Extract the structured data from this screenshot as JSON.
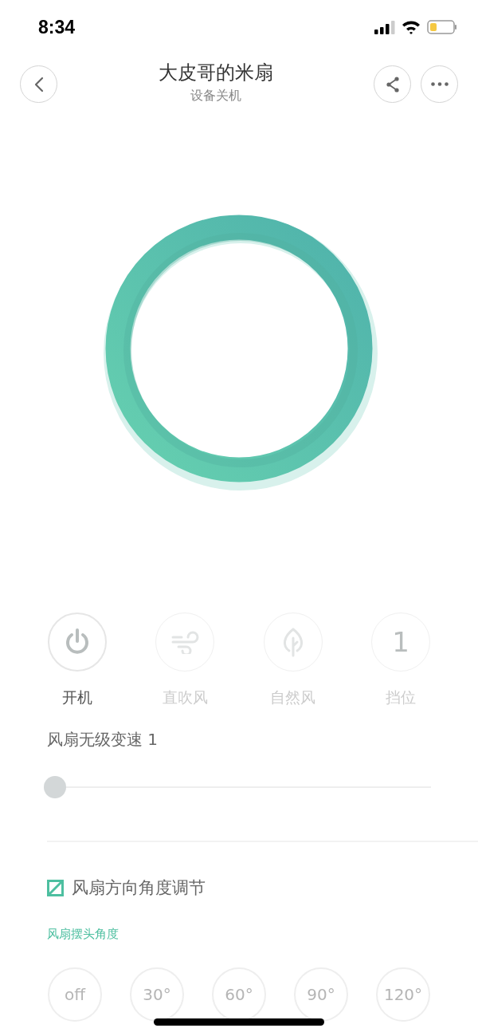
{
  "status_bar": {
    "time": "8:34"
  },
  "header": {
    "title": "大皮哥的米扇",
    "subtitle": "设备关机"
  },
  "modes": [
    {
      "kind": "power",
      "label": "开机",
      "disabled": false
    },
    {
      "kind": "direct",
      "label": "直吹风",
      "disabled": true
    },
    {
      "kind": "natural",
      "label": "自然风",
      "disabled": true
    },
    {
      "kind": "gear",
      "label": "挡位",
      "value": "1",
      "disabled": true
    }
  ],
  "speed": {
    "label": "风扇无级变速 1",
    "level": 0
  },
  "direction": {
    "title": "风扇方向角度调节",
    "subtitle": "风扇摆头角度",
    "angles": [
      "off",
      "30°",
      "60°",
      "90°",
      "120°"
    ]
  }
}
